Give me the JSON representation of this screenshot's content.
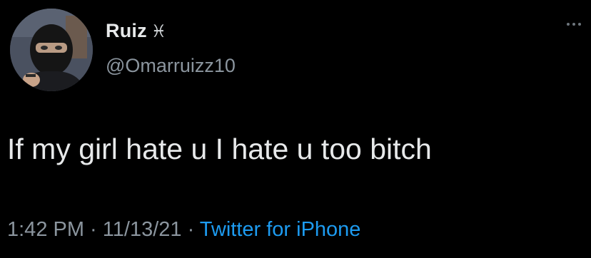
{
  "author": {
    "display_name": "Ruiz",
    "name_emoji": "♓",
    "handle": "@Omarruizz10"
  },
  "tweet": {
    "text": "If my girl hate u I hate u too bitch"
  },
  "meta": {
    "time": "1:42 PM",
    "separator_1": " · ",
    "date": "11/13/21",
    "separator_2": " · ",
    "source": "Twitter for iPhone"
  },
  "icons": {
    "more": "more-options-icon",
    "avatar": "profile-photo"
  },
  "colors": {
    "background": "#000000",
    "primary_text": "#e7e9ea",
    "secondary_text": "#8b959e",
    "link": "#1d9bf0"
  }
}
